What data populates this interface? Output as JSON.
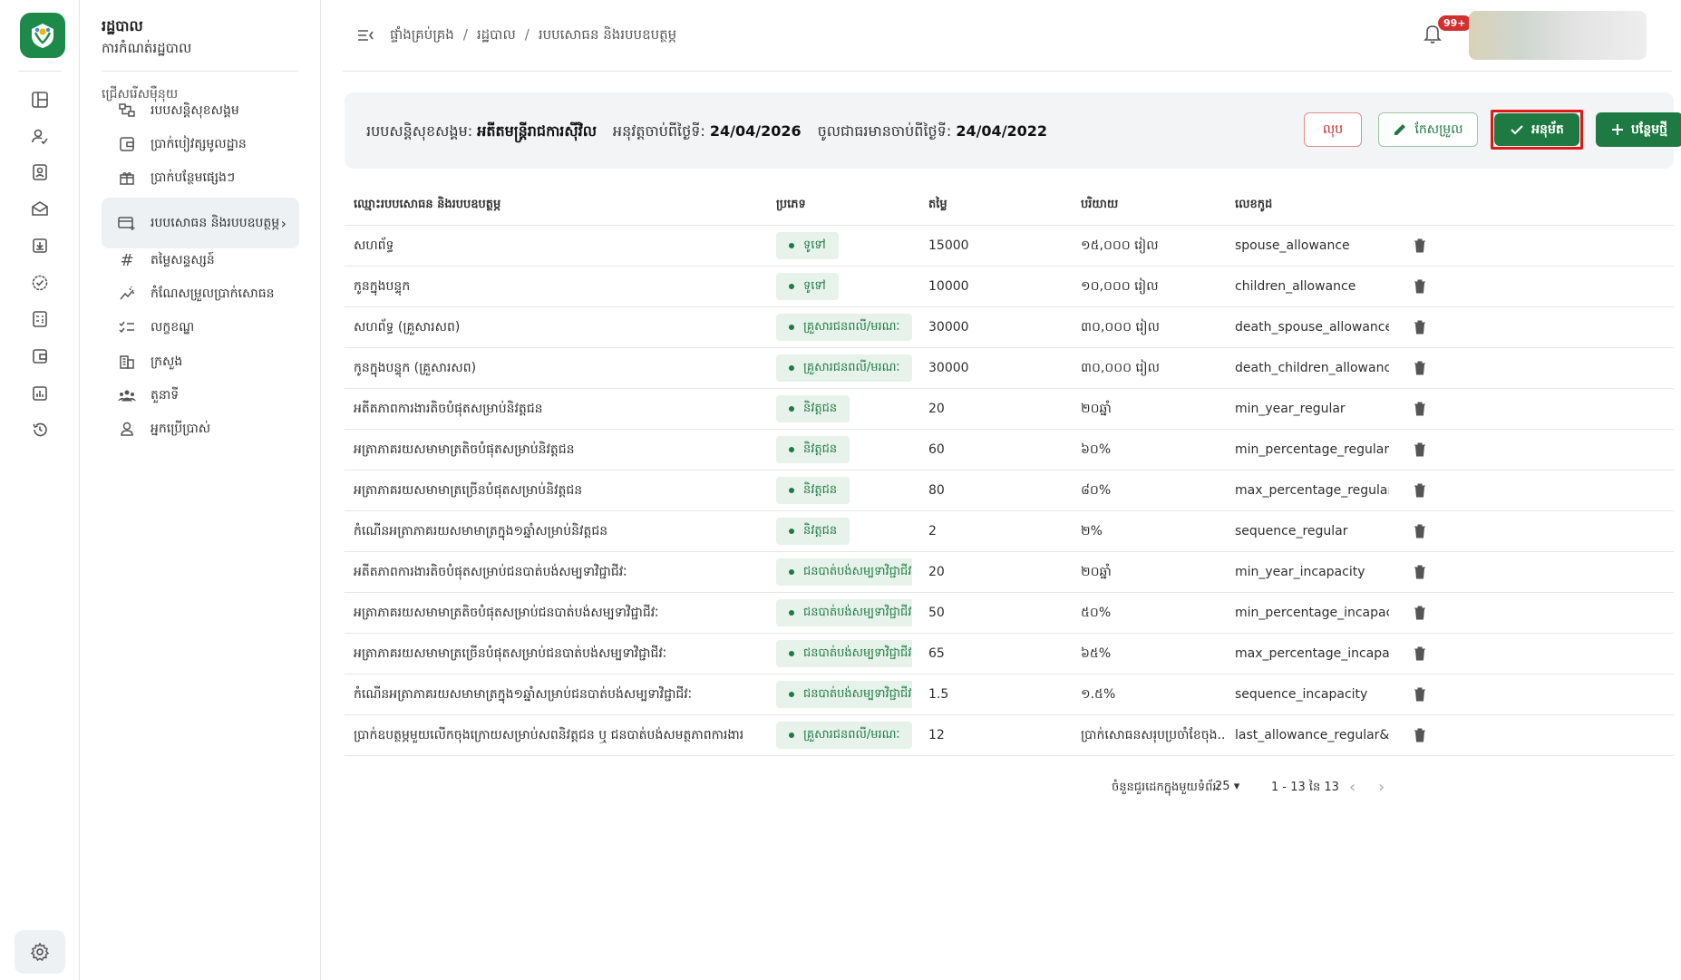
{
  "app": {
    "title": "រដ្ឋបាល",
    "subtitle": "ការកំណត់រដ្ឋបាល",
    "brand_color": "#1e8a4a"
  },
  "rail_icons": [
    "dashboard-icon",
    "user-check-icon",
    "id-card-icon",
    "mail-open-icon",
    "download-box-icon",
    "badge-check-icon",
    "calculator-icon",
    "wallet-icon",
    "bar-chart-icon",
    "history-icon"
  ],
  "nav": {
    "section_label": "ជ្រើសរើសម៉ឺនុយ",
    "items": [
      {
        "label": "របបសន្តិសុខសង្គម",
        "icon": "hierarchy-icon"
      },
      {
        "label": "ប្រាក់បៀវត្សមូលដ្ឋាន",
        "icon": "wallet-icon"
      },
      {
        "label": "ប្រាក់បន្ថែមផ្សេងៗ",
        "icon": "gift-icon"
      },
      {
        "label": "របបសោធន និងរបបឧបត្ថម្ភ",
        "icon": "card-plus-icon",
        "active": true
      },
      {
        "label": "តម្លៃសន្ទស្សន៍",
        "icon": "hash-icon"
      },
      {
        "label": "កំណែសម្រួលប្រាក់សោធន",
        "icon": "trend-icon"
      },
      {
        "label": "លក្ខខណ្ឌ",
        "icon": "checklist-icon"
      },
      {
        "label": "ក្រសួង",
        "icon": "building-icon"
      },
      {
        "label": "តួនាទី",
        "icon": "group-icon"
      },
      {
        "label": "អ្នកប្រើប្រាស់",
        "icon": "user-icon"
      }
    ]
  },
  "breadcrumb": [
    "ផ្ទាំងគ្រប់គ្រង",
    "រដ្ឋបាល",
    "របបសោធន និងរបបឧបត្ថម្ភ"
  ],
  "notifications": {
    "badge": "99+"
  },
  "info": {
    "scheme_label": "របបសន្តិសុខសង្គម:",
    "scheme_value": "អតីតមន្ត្រីរាជការស៊ីវិល",
    "effective_label": "អនុវត្តចាប់ពីថ្ងៃទី:",
    "effective_value": "24/04/2026",
    "enforced_label": "ចូលជាធរមានចាប់ពីថ្ងៃទី:",
    "enforced_value": "24/04/2022"
  },
  "actions": {
    "delete": "លុប",
    "edit": "កែសម្រួល",
    "approve": "អនុម័ត",
    "add": "បន្ថែមថ្មី"
  },
  "table": {
    "headers": {
      "name": "ឈ្មោះរបបសោធន និងរបបឧបត្ថម្ភ",
      "type": "ប្រភេទ",
      "value": "តម្លៃ",
      "description": "បរិយាយ",
      "code": "លេខកូដ"
    },
    "rows": [
      {
        "name": "សហព័ទ្ធ",
        "type": "ទូទៅ",
        "value": "15000",
        "desc": "១៥,០០០ រៀល",
        "code": "spouse_allowance"
      },
      {
        "name": "កូនក្នុងបន្ទុក",
        "type": "ទូទៅ",
        "value": "10000",
        "desc": "១០,០០០ រៀល",
        "code": "children_allowance"
      },
      {
        "name": "សហព័ទ្ធ (គ្រួសារសព)",
        "type": "គ្រួសារជនពលី/មរណៈ",
        "value": "30000",
        "desc": "៣០,០០០ រៀល",
        "code": "death_spouse_allowance"
      },
      {
        "name": "កូនក្នុងបន្ទុក (គ្រួសារសព)",
        "type": "គ្រួសារជនពលី/មរណៈ",
        "value": "30000",
        "desc": "៣០,០០០ រៀល",
        "code": "death_children_allowance"
      },
      {
        "name": "អតីតភាពការងារតិចបំផុតសម្រាប់និវត្តជន",
        "type": "និវត្តជន",
        "value": "20",
        "desc": "២០ឆ្នាំ",
        "code": "min_year_regular"
      },
      {
        "name": "អត្រាភាគរយសមាមាត្រតិចបំផុតសម្រាប់និវត្តជន",
        "type": "និវត្តជន",
        "value": "60",
        "desc": "៦០%",
        "code": "min_percentage_regular"
      },
      {
        "name": "អត្រាភាគរយសមាមាត្រច្រើនបំផុតសម្រាប់និវត្តជន",
        "type": "និវត្តជន",
        "value": "80",
        "desc": "៨០%",
        "code": "max_percentage_regular"
      },
      {
        "name": "កំណើនអត្រាភាគរយសមាមាត្រក្នុង១ឆ្នាំសម្រាប់និវត្តជន",
        "type": "និវត្តជន",
        "value": "2",
        "desc": "២%",
        "code": "sequence_regular"
      },
      {
        "name": "អតីតភាពការងារតិចបំផុតសម្រាប់ជនបាត់បង់សម្បទាវិជ្ជាជីវៈ",
        "type": "ជនបាត់បង់សម្បទាវិជ្ជាជីវៈ",
        "value": "20",
        "desc": "២០ឆ្នាំ",
        "code": "min_year_incapacity"
      },
      {
        "name": "អត្រាភាគរយសមាមាត្រតិចបំផុតសម្រាប់ជនបាត់បង់សម្បទាវិជ្ជាជីវៈ",
        "type": "ជនបាត់បង់សម្បទាវិជ្ជាជីវៈ",
        "value": "50",
        "desc": "៥០%",
        "code": "min_percentage_incapac..."
      },
      {
        "name": "អត្រាភាគរយសមាមាត្រច្រើនបំផុតសម្រាប់ជនបាត់បង់សម្បទាវិជ្ជាជីវៈ",
        "type": "ជនបាត់បង់សម្បទាវិជ្ជាជីវៈ",
        "value": "65",
        "desc": "៦៥%",
        "code": "max_percentage_incapa..."
      },
      {
        "name": "កំណើនអត្រាភាគរយសមាមាត្រក្នុង១ឆ្នាំសម្រាប់ជនបាត់បង់សម្បទាវិជ្ជាជីវៈ",
        "type": "ជនបាត់បង់សម្បទាវិជ្ជាជីវៈ",
        "value": "1.5",
        "desc": "១.៥%",
        "code": "sequence_incapacity"
      },
      {
        "name": "ប្រាក់ឧបត្ថម្ភមួយលើកចុងក្រោយសម្រាប់សពនិវត្តជន ឬ ជនបាត់បង់សមត្ថភាពការងារ",
        "type": "គ្រួសារជនពលី/មរណៈ",
        "value": "12",
        "desc": "ប្រាក់សោធនសរុបប្រចាំខែចុង...",
        "code": "last_allowance_regular&i..."
      }
    ]
  },
  "pagination": {
    "rows_per_page_label": "ចំនួនជួរដេកក្នុងមួយទំព័រ:",
    "rows_per_page": "25",
    "range": "1 - 13 នៃ 13"
  }
}
